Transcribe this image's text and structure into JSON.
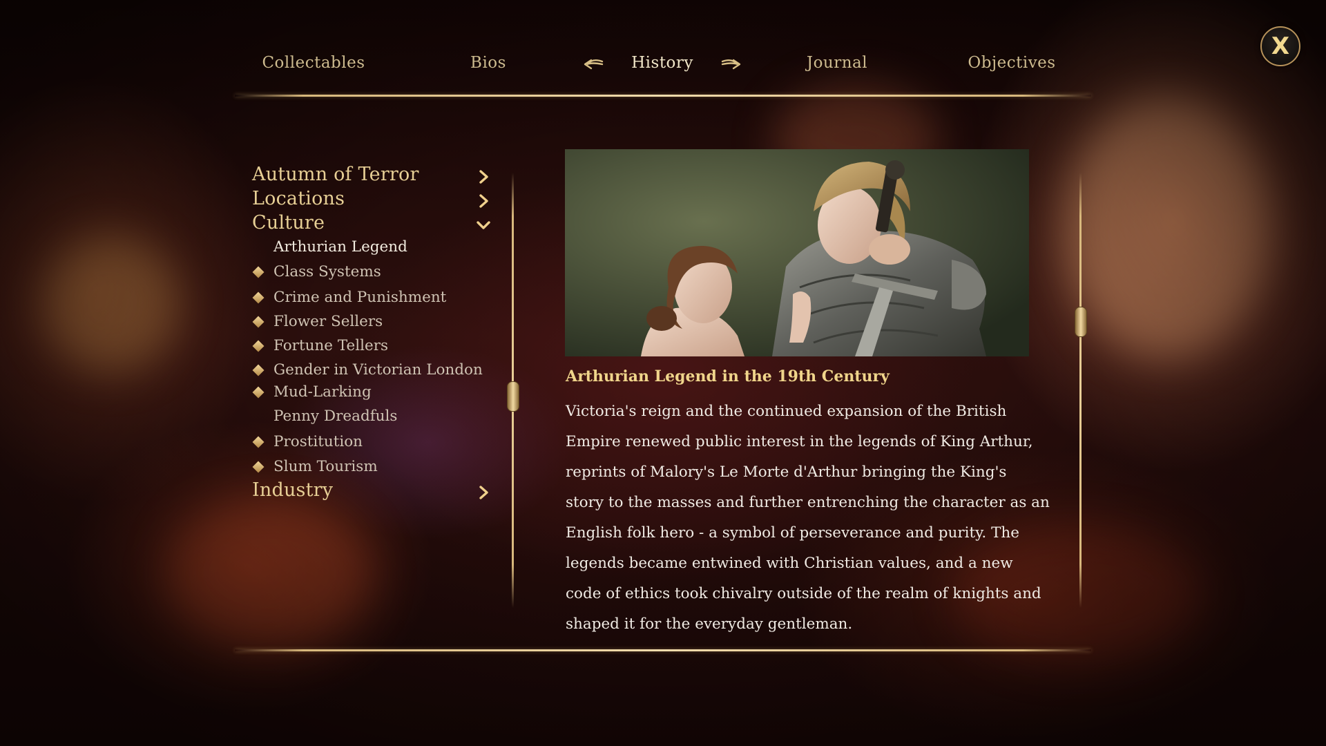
{
  "nav": {
    "tabs": [
      {
        "label": "Collectables"
      },
      {
        "label": "Bios"
      },
      {
        "label": "History"
      },
      {
        "label": "Journal"
      },
      {
        "label": "Objectives"
      }
    ],
    "active_tab": "History"
  },
  "close": {
    "label": "X"
  },
  "menu": {
    "categories": [
      {
        "label": "Autumn of Terror",
        "state": "collapsed"
      },
      {
        "label": "Locations",
        "state": "collapsed"
      },
      {
        "label": "Culture",
        "state": "expanded"
      },
      {
        "label": "Industry",
        "state": "collapsed"
      }
    ],
    "culture_items": [
      {
        "label": "Arthurian Legend",
        "selected": true,
        "marker": false
      },
      {
        "label": "Class Systems",
        "marker": true
      },
      {
        "label": "Crime and Punishment",
        "marker": true
      },
      {
        "label": "Flower Sellers",
        "marker": true
      },
      {
        "label": "Fortune Tellers",
        "marker": true
      },
      {
        "label": "Gender in Victorian London",
        "marker": true
      },
      {
        "label": "Mud-Larking",
        "marker": true
      },
      {
        "label": "Penny Dreadfuls",
        "marker": false
      },
      {
        "label": "Prostitution",
        "marker": true
      },
      {
        "label": "Slum Tourism",
        "marker": true
      }
    ]
  },
  "article": {
    "title": "Arthurian Legend in the 19th Century",
    "lines": [
      "Victoria's reign and the continued expansion of the British",
      "Empire renewed public interest in the legends of King Arthur,",
      "reprints of Malory's Le Morte d'Arthur bringing the King's",
      "story to the masses and further entrenching the character as an",
      "English folk hero - a symbol of perseverance and purity. The",
      "legends became entwined with Christian values, and a new",
      "code of ethics took chivalry outside of the realm of knights and",
      "shaped it for the everyday gentleman."
    ]
  },
  "colors": {
    "gold": "#e7cf95",
    "gold_title": "#f0d58b",
    "body_text": "#f0ebe4",
    "sub_text": "#cfc3b3"
  }
}
